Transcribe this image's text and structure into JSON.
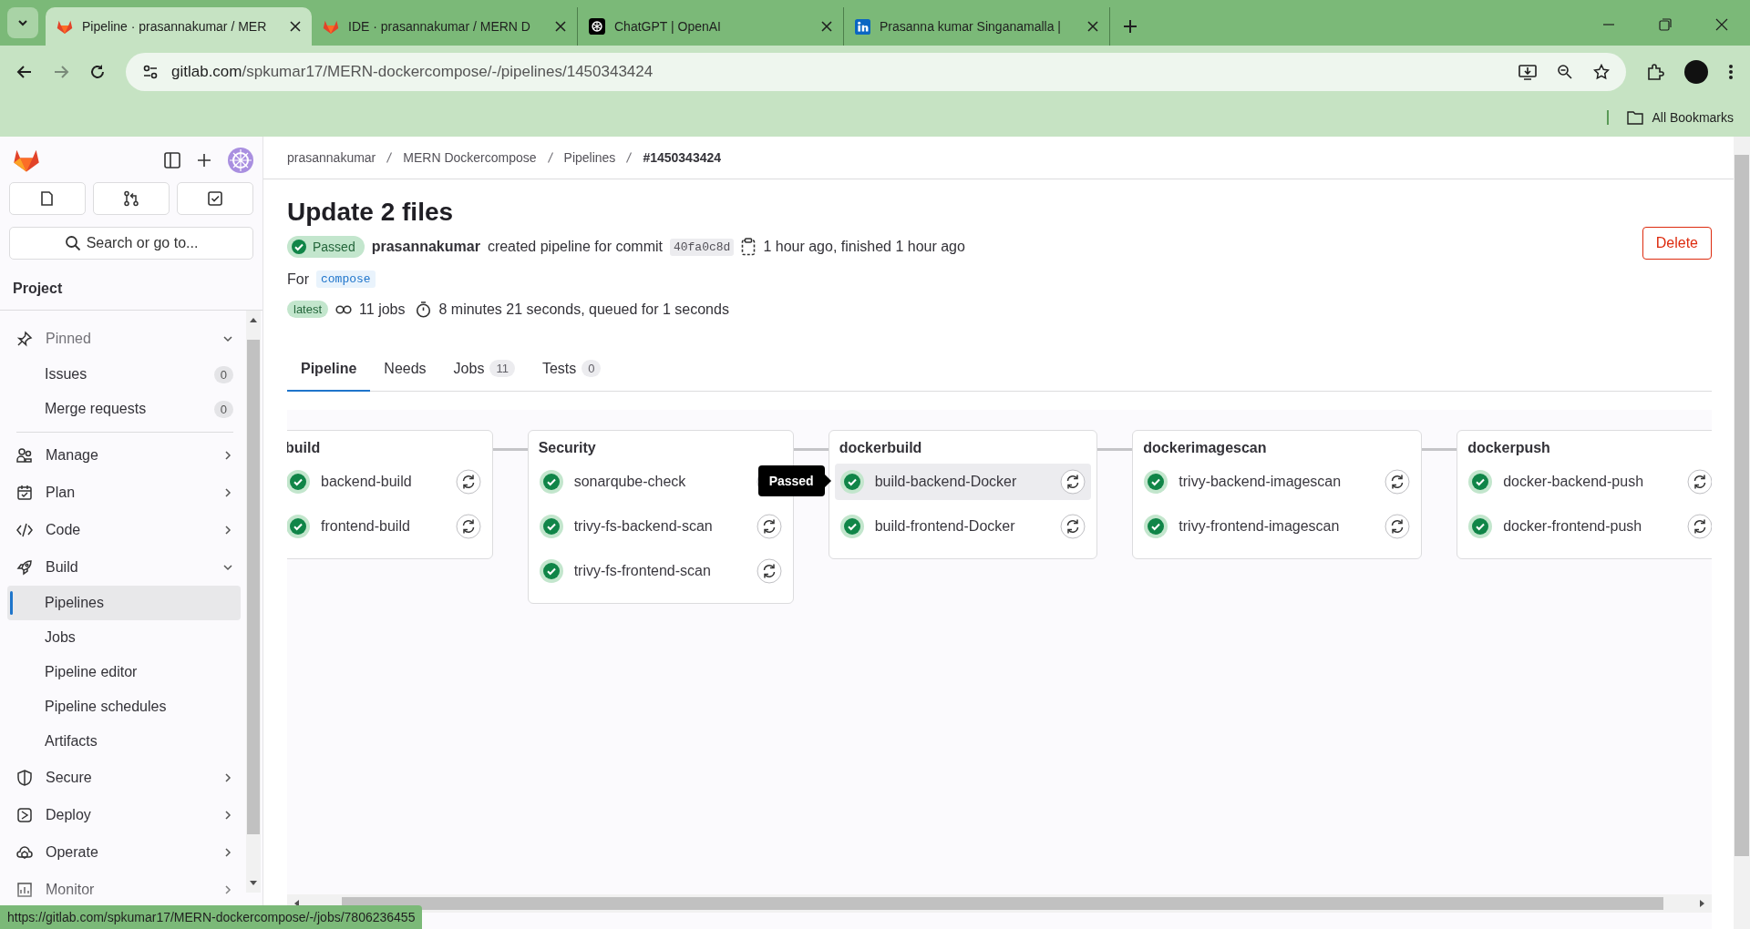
{
  "browser": {
    "tabs": [
      {
        "title": "Pipeline · prasannakumar / MER",
        "kind": "gitlab",
        "selected": true
      },
      {
        "title": "IDE · prasannakumar / MERN D",
        "kind": "gitlab",
        "selected": false
      },
      {
        "title": "ChatGPT | OpenAI",
        "kind": "chatgpt",
        "selected": false
      },
      {
        "title": "Prasanna kumar Singanamalla |",
        "kind": "linkedin",
        "selected": false
      }
    ],
    "url_host": "gitlab.com",
    "url_path": "/spkumar17/MERN-dockercompose/-/pipelines/1450343424",
    "bookmarks": "All Bookmarks"
  },
  "sidebar": {
    "search": {
      "placeholder": "Search or go to..."
    },
    "section": "Project",
    "items": [
      {
        "label": "Pinned",
        "expanded": true,
        "children": [
          {
            "label": "Issues",
            "count": "0",
            "selected": false
          },
          {
            "label": "Merge requests",
            "count": "0",
            "selected": false
          }
        ]
      },
      {
        "label": "Manage",
        "expanded": false
      },
      {
        "label": "Plan",
        "expanded": false
      },
      {
        "label": "Code",
        "expanded": false
      },
      {
        "label": "Build",
        "expanded": true,
        "children": [
          {
            "label": "Pipelines",
            "selected": true
          },
          {
            "label": "Jobs",
            "selected": false
          },
          {
            "label": "Pipeline editor",
            "selected": false
          },
          {
            "label": "Pipeline schedules",
            "selected": false
          },
          {
            "label": "Artifacts",
            "selected": false
          }
        ]
      },
      {
        "label": "Secure",
        "expanded": false
      },
      {
        "label": "Deploy",
        "expanded": false
      },
      {
        "label": "Operate",
        "expanded": false
      },
      {
        "label": "Monitor",
        "expanded": false
      }
    ]
  },
  "breadcrumb": [
    "prasannakumar",
    "MERN Dockercompose",
    "Pipelines",
    "#1450343424"
  ],
  "pipeline": {
    "title": "Update 2 files",
    "passed": true,
    "status_label": "Passed",
    "author": "prasannakumar",
    "action": "created pipeline for commit",
    "commit": "40fa0c8d",
    "time": "1 hour ago, finished 1 hour ago",
    "ref_prefix": "For",
    "ref": "compose",
    "badge": "latest",
    "jobs": "11 jobs",
    "duration": "8 minutes 21 seconds, queued for 1 seconds",
    "delete": "Delete"
  },
  "tabs": [
    {
      "label": "Pipeline",
      "selected": true
    },
    {
      "label": "Needs",
      "selected": false
    },
    {
      "label": "Jobs",
      "count": "11",
      "selected": false
    },
    {
      "label": "Tests",
      "count": "0",
      "selected": false
    }
  ],
  "stages": [
    {
      "name": "build",
      "jobs": [
        {
          "name": "backend-build",
          "passed": true,
          "hovered": false
        },
        {
          "name": "frontend-build",
          "passed": true,
          "hovered": false
        }
      ]
    },
    {
      "name": "Security",
      "jobs": [
        {
          "name": "sonarqube-check",
          "passed": true,
          "hovered": false
        },
        {
          "name": "trivy-fs-backend-scan",
          "passed": true,
          "hovered": false
        },
        {
          "name": "trivy-fs-frontend-scan",
          "passed": true,
          "hovered": false
        }
      ]
    },
    {
      "name": "dockerbuild",
      "jobs": [
        {
          "name": "build-backend-Docker",
          "passed": true,
          "hovered": true
        },
        {
          "name": "build-frontend-Docker",
          "passed": true,
          "hovered": false
        }
      ]
    },
    {
      "name": "dockerimagescan",
      "jobs": [
        {
          "name": "trivy-backend-imagescan",
          "passed": true,
          "hovered": false
        },
        {
          "name": "trivy-frontend-imagescan",
          "passed": true,
          "hovered": false
        }
      ]
    },
    {
      "name": "dockerpush",
      "jobs": [
        {
          "name": "docker-backend-push",
          "passed": true,
          "hovered": false
        },
        {
          "name": "docker-frontend-push",
          "passed": true,
          "hovered": false
        }
      ]
    }
  ],
  "tooltip": "Passed",
  "status_url": "https://gitlab.com/spkumar17/MERN-dockercompose/-/jobs/7806236455"
}
